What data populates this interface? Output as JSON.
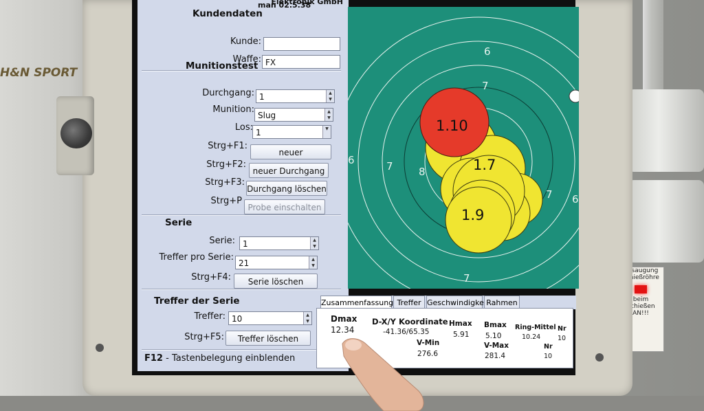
{
  "background": {
    "logo_text": "H&N SPORT",
    "warning_label": {
      "line1": "Absaugung",
      "line2": "Schießröhre",
      "line3": "beim Schießen",
      "line4": "AN!!!"
    }
  },
  "app": {
    "title_partial": "Elektronik GmbH",
    "version_partial": "man 02.5.38",
    "corner_tag": "NONE"
  },
  "kundendaten": {
    "heading": "Kundendaten",
    "kunde_label": "Kunde:",
    "kunde_value": "",
    "waffe_label": "Waffe:",
    "waffe_value": "FX"
  },
  "munitionstest": {
    "heading": "Munitionstest",
    "durchgang_label": "Durchgang:",
    "durchgang_value": "1",
    "munition_label": "Munition:",
    "munition_value": "Slug",
    "los_label": "Los:",
    "los_value": "1",
    "shortcuts": [
      {
        "key": "Strg+F1:",
        "button": "neuer Munitionstest",
        "enabled": true
      },
      {
        "key": "Strg+F2:",
        "button": "neuer Durchgang",
        "enabled": true
      },
      {
        "key": "Strg+F3:",
        "button": "Durchgang löschen",
        "enabled": true
      },
      {
        "key": "Strg+P",
        "button": "Probe einschalten",
        "enabled": false
      }
    ]
  },
  "serie": {
    "heading": "Serie",
    "serie_label": "Serie:",
    "serie_value": "1",
    "treffer_pro_serie_label": "Treffer pro Serie:",
    "treffer_pro_serie_value": "21",
    "shortcut_key": "Strg+F4:",
    "shortcut_button": "Serie löschen"
  },
  "treffer_der_serie": {
    "heading": "Treffer der Serie",
    "treffer_label": "Treffer:",
    "treffer_value": "10",
    "shortcut_key": "Strg+F5:",
    "shortcut_button": "Treffer löschen"
  },
  "footer": {
    "key": "F12",
    "text": " - Tastenbelegung einblenden"
  },
  "target": {
    "ring_labels": [
      "6",
      "7",
      "6",
      "7",
      "8",
      "7",
      "6",
      "7"
    ],
    "hits_labeled": [
      {
        "label": "1.10",
        "color": "#e53a2a"
      },
      {
        "label": "1.7",
        "color": "#f0e531"
      },
      {
        "label": "1.9",
        "color": "#f0e531"
      }
    ],
    "background_color": "#1d8f7a",
    "hit_color": "#f0e531",
    "latest_hit_color": "#e53a2a"
  },
  "tabs": [
    "Zusammenfassung",
    "Treffer",
    "Geschwindigkeit",
    "Rahmen"
  ],
  "summary": {
    "dmax_label": "Dmax",
    "dmax_value": "12.34",
    "dxy_label": "D-X/Y Koordinate",
    "dxy_value": "-41.36/65.35",
    "hmax_label": "Hmax",
    "hmax_value": "5.91",
    "bmax_label": "Bmax",
    "bmax_value": "5.10",
    "ring_label": "Ring-Mittel",
    "ring_value": "10.24",
    "nr_label": "Nr",
    "nr_value": "10",
    "vmin_label": "V-Min",
    "vmin_value": "276.6",
    "vmax_label": "V-Max",
    "vmax_value": "281.4",
    "nr2_label": "Nr",
    "nr2_value": "10"
  }
}
